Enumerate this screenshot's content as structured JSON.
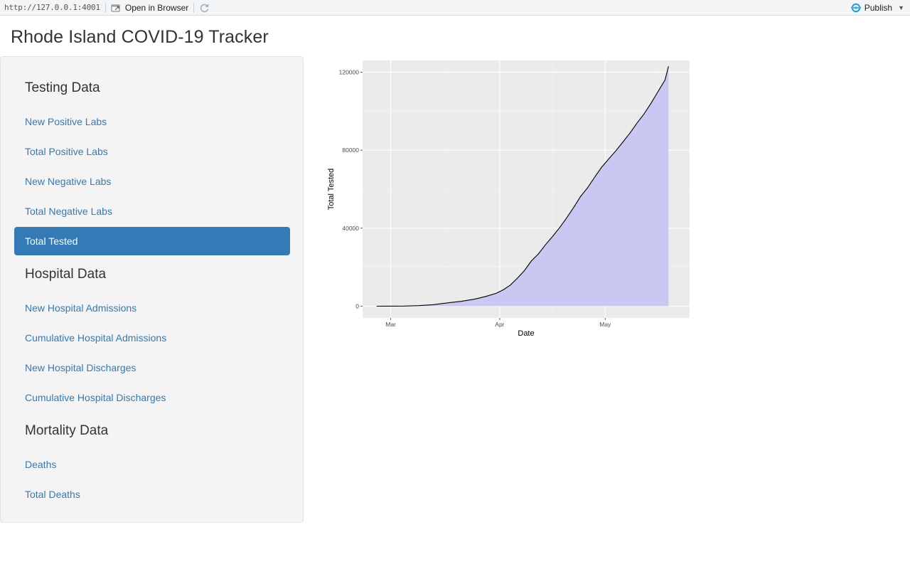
{
  "toolbar": {
    "url": "http://127.0.0.1:4001",
    "open_in_browser_label": "Open in Browser",
    "publish_label": "Publish",
    "colors": {
      "publish_icon": "#1a9fd8"
    }
  },
  "page": {
    "title": "Rhode Island COVID-19 Tracker"
  },
  "sidebar": {
    "sections": [
      {
        "title": "Testing Data",
        "items": [
          {
            "label": "New Positive Labs",
            "active": false
          },
          {
            "label": "Total Positive Labs",
            "active": false
          },
          {
            "label": "New Negative Labs",
            "active": false
          },
          {
            "label": "Total Negative Labs",
            "active": false
          },
          {
            "label": "Total Tested",
            "active": true
          }
        ]
      },
      {
        "title": "Hospital Data",
        "items": [
          {
            "label": "New Hospital Admissions",
            "active": false
          },
          {
            "label": "Cumulative Hospital Admissions",
            "active": false
          },
          {
            "label": "New Hospital Discharges",
            "active": false
          },
          {
            "label": "Cumulative Hospital Discharges",
            "active": false
          }
        ]
      },
      {
        "title": "Mortality Data",
        "items": [
          {
            "label": "Deaths",
            "active": false
          },
          {
            "label": "Total Deaths",
            "active": false
          }
        ]
      }
    ],
    "colors": {
      "link": "#337ab7",
      "active_bg": "#337ab7",
      "active_text": "#ffffff"
    }
  },
  "chart_data": {
    "type": "area",
    "xlabel": "Date",
    "ylabel": "Total Tested",
    "x_tick_labels": [
      "Mar",
      "Apr",
      "May"
    ],
    "x_ticks": [
      "2020-03-01",
      "2020-04-01",
      "2020-05-01"
    ],
    "y_ticks": [
      0,
      40000,
      80000,
      120000
    ],
    "xlim": [
      "2020-02-22",
      "2020-05-25"
    ],
    "ylim": [
      -6000,
      126000
    ],
    "grid": true,
    "fill_color": "#c8c8f2",
    "line_color": "#000000",
    "panel_color": "#ebebeb",
    "series": [
      {
        "x": [
          "2020-02-26",
          "2020-03-01",
          "2020-03-05",
          "2020-03-09",
          "2020-03-13",
          "2020-03-17",
          "2020-03-21",
          "2020-03-25",
          "2020-03-28",
          "2020-03-31",
          "2020-04-02",
          "2020-04-04",
          "2020-04-06",
          "2020-04-08",
          "2020-04-10",
          "2020-04-12",
          "2020-04-14",
          "2020-04-16",
          "2020-04-18",
          "2020-04-20",
          "2020-04-22",
          "2020-04-24",
          "2020-04-26",
          "2020-04-28",
          "2020-04-30",
          "2020-05-02",
          "2020-05-04",
          "2020-05-06",
          "2020-05-08",
          "2020-05-10",
          "2020-05-12",
          "2020-05-14",
          "2020-05-16",
          "2020-05-18",
          "2020-05-19"
        ],
        "y": [
          0,
          50,
          100,
          300,
          800,
          1700,
          2500,
          3700,
          5000,
          6600,
          8400,
          10800,
          14300,
          18200,
          23200,
          26800,
          31500,
          35700,
          40200,
          45200,
          50600,
          56300,
          60800,
          66200,
          71300,
          75500,
          79600,
          84100,
          88700,
          93800,
          98500,
          104000,
          110000,
          116000,
          123000
        ]
      }
    ]
  }
}
